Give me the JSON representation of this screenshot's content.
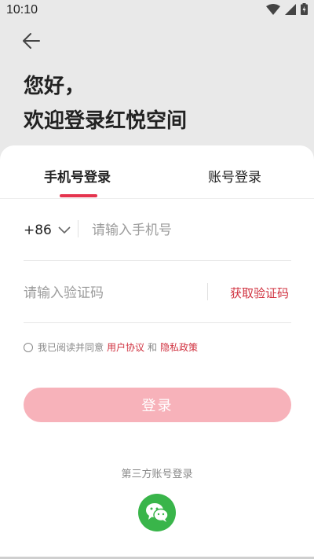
{
  "status_bar": {
    "time": "10:10"
  },
  "header": {
    "greeting_line1": "您好，",
    "greeting_line2": "欢迎登录红悦空间"
  },
  "tabs": [
    {
      "label": "手机号登录",
      "active": true
    },
    {
      "label": "账号登录",
      "active": false
    }
  ],
  "form": {
    "country_code": "+86",
    "phone_placeholder": "请输入手机号",
    "code_placeholder": "请输入验证码",
    "get_code_label": "获取验证码"
  },
  "agreement": {
    "prefix": "我已阅读并同意",
    "user_agreement": "用户协议",
    "and": "和",
    "privacy_policy": "隐私政策"
  },
  "login_button": "登录",
  "third_party": {
    "label": "第三方账号登录",
    "provider": "wechat-icon"
  },
  "colors": {
    "accent": "#d0313f",
    "tab_indicator": "#e5344e",
    "login_button_disabled": "#f7b2ba",
    "wechat": "#39b54a"
  }
}
